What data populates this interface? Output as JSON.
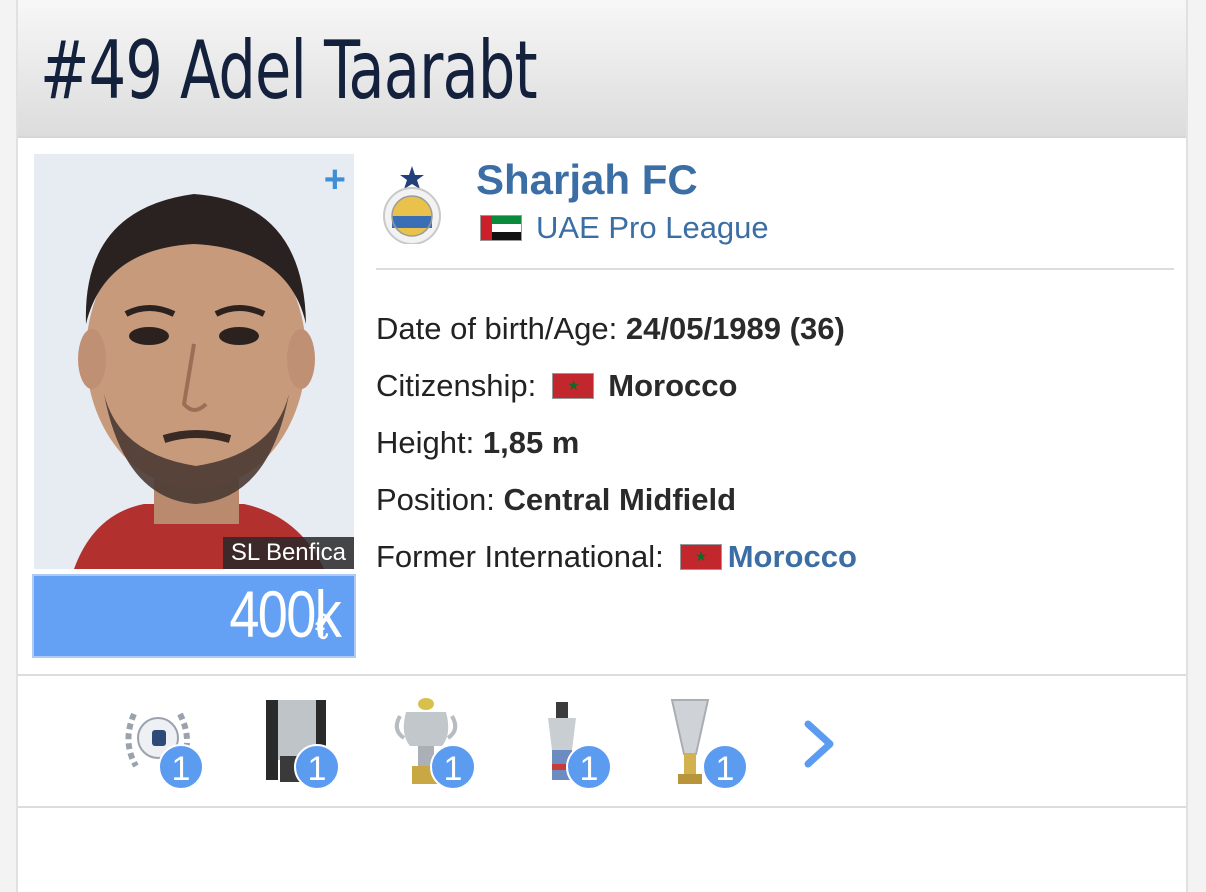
{
  "header": {
    "title": "#49 Adel Taarabt"
  },
  "photo": {
    "caption": "SL Benfica",
    "plus": "+"
  },
  "market_value": {
    "currency": "€",
    "amount": "400k"
  },
  "club": {
    "name": "Sharjah FC",
    "league": "UAE Pro League"
  },
  "facts": {
    "dob_label": "Date of birth/Age:",
    "dob_value": "24/05/1989 (36)",
    "citizenship_label": "Citizenship:",
    "citizenship_value": "Morocco",
    "height_label": "Height:",
    "height_value": "1,85 m",
    "position_label": "Position:",
    "position_value": "Central Midfield",
    "international_label": "Former International:",
    "international_value": "Morocco"
  },
  "trophies": [
    {
      "icon": "laurel-trophy-icon",
      "count": "1"
    },
    {
      "icon": "cup-trophy-icon",
      "count": "1"
    },
    {
      "icon": "league-trophy-icon",
      "count": "1"
    },
    {
      "icon": "small-cup-trophy-icon",
      "count": "1"
    },
    {
      "icon": "tall-trophy-icon",
      "count": "1"
    }
  ],
  "colors": {
    "accent": "#3b6ea5",
    "badge": "#5b9cf0",
    "value_bg": "#64a0f3"
  }
}
